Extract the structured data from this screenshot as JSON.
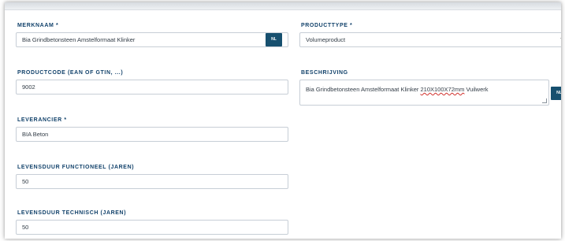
{
  "form": {
    "merknaam": {
      "label": "MERKNAAM *",
      "value": "Bia Grindbetonsteen Amstelformaat Klinker",
      "lang_badge": "NL"
    },
    "producttype": {
      "label": "PRODUCTTYPE *",
      "value": "Volumeproduct",
      "arrow": "▼"
    },
    "productcode": {
      "label": "PRODUCTCODE (EAN OF GTIN, ...)",
      "value": "9002"
    },
    "beschrijving": {
      "label": "BESCHRIJVING",
      "value_before": "Bia Grindbetonsteen Amstelformaat Klinker ",
      "value_misspelled1": "210X100X72mm",
      "value_after": " Vuilwerk",
      "lang_badge": "NL"
    },
    "leverancier": {
      "label": "LEVERANCIER *",
      "value": "BIA Beton"
    },
    "levensduur_functioneel": {
      "label": "LEVENSDUUR FUNCTIONEEL (JAREN)",
      "value": "50"
    },
    "levensduur_technisch": {
      "label": "LEVENSDUUR TECHNISCH (JAREN)",
      "value": "50"
    }
  },
  "colors": {
    "label": "#12426b",
    "badge": "#17506f",
    "border": "#c7ced6"
  }
}
